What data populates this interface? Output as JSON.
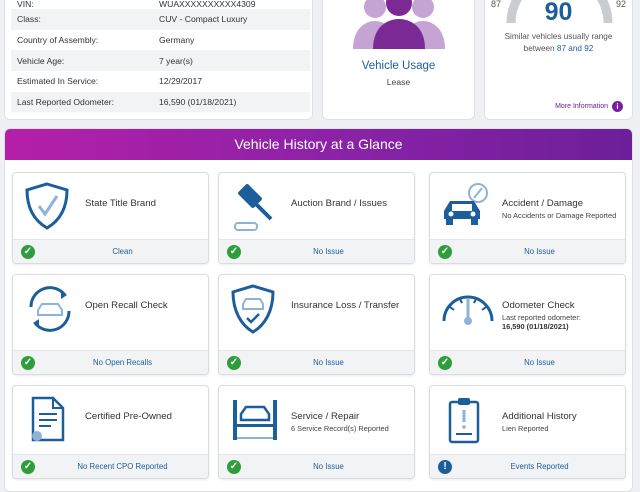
{
  "vehicle_info": {
    "rows": [
      {
        "label": "VIN:",
        "value": "WUAXXXXXXXXXX4309"
      },
      {
        "label": "Class:",
        "value": "CUV - Compact Luxury"
      },
      {
        "label": "Country of Assembly:",
        "value": "Germany"
      },
      {
        "label": "Vehicle Age:",
        "value": "7 year(s)"
      },
      {
        "label": "Estimated In Service:",
        "value": "12/29/2017"
      },
      {
        "label": "Last Reported Odometer:",
        "value": "16,590 (01/18/2021)"
      }
    ]
  },
  "usage": {
    "title": "Vehicle Usage",
    "value": "Lease",
    "icon": "people-group-icon"
  },
  "score": {
    "value": "90",
    "low": "87",
    "high": "92",
    "range_line1": "Similar vehicles usually range",
    "range_prefix": "between",
    "range_value": "87 and 92",
    "more_info": "More Information",
    "more_info_icon": "i"
  },
  "history": {
    "title": "Vehicle History at a Glance",
    "tiles": [
      {
        "title": "State Title Brand",
        "sub": "",
        "sub2": "",
        "status": "Clean",
        "status_icon": "✓",
        "icon": "shield-check-icon"
      },
      {
        "title": "Auction Brand / Issues",
        "sub": "",
        "sub2": "",
        "status": "No Issue",
        "status_icon": "✓",
        "icon": "gavel-icon"
      },
      {
        "title": "Accident / Damage",
        "sub": "No Accidents or Damage Reported",
        "sub2": "",
        "status": "No Issue",
        "status_icon": "✓",
        "icon": "car-damage-icon"
      },
      {
        "title": "Open Recall Check",
        "sub": "",
        "sub2": "",
        "status": "No Open Recalls",
        "status_icon": "✓",
        "icon": "car-recall-icon"
      },
      {
        "title": "Insurance Loss / Transfer",
        "sub": "",
        "sub2": "",
        "status": "No Issue",
        "status_icon": "✓",
        "icon": "shield-car-icon"
      },
      {
        "title": "Odometer Check",
        "sub": "Last reported odometer:",
        "sub2": "16,590 (01/18/2021)",
        "status": "No Issue",
        "status_icon": "✓",
        "icon": "odometer-icon"
      },
      {
        "title": "Certified Pre-Owned",
        "sub": "",
        "sub2": "",
        "status": "No Recent CPO Reported",
        "status_icon": "✓",
        "icon": "certificate-icon"
      },
      {
        "title": "Service / Repair",
        "sub": "6 Service Record(s) Reported",
        "sub2": "",
        "status": "No Issue",
        "status_icon": "✓",
        "icon": "car-lift-icon"
      },
      {
        "title": "Additional History",
        "sub": "Lien Reported",
        "sub2": "",
        "status": "Events Reported",
        "status_icon": "!",
        "icon": "clipboard-alert-icon"
      }
    ]
  },
  "colors": {
    "accent_blue": "#1b5e9b",
    "banner_purple": "#8d22a8",
    "ok_green": "#2e9e3c"
  }
}
